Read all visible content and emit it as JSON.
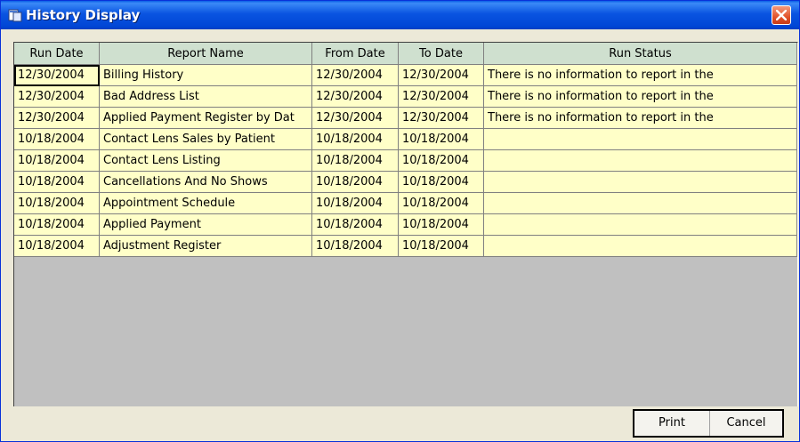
{
  "window": {
    "title": "History Display"
  },
  "table": {
    "headers": [
      "Run Date",
      "Report Name",
      "From Date",
      "To Date",
      "Run Status"
    ],
    "rows": [
      [
        "12/30/2004",
        "Billing History",
        "12/30/2004",
        "12/30/2004",
        "There is no information to report in the"
      ],
      [
        "12/30/2004",
        "Bad Address List",
        "12/30/2004",
        "12/30/2004",
        "There is no information to report in the"
      ],
      [
        "12/30/2004",
        "Applied Payment Register by Dat",
        "12/30/2004",
        "12/30/2004",
        "There is no information to report in the"
      ],
      [
        "10/18/2004",
        "Contact Lens Sales by Patient",
        "10/18/2004",
        "10/18/2004",
        ""
      ],
      [
        "10/18/2004",
        "Contact Lens Listing",
        "10/18/2004",
        "10/18/2004",
        ""
      ],
      [
        "10/18/2004",
        "Cancellations And No Shows",
        "10/18/2004",
        "10/18/2004",
        ""
      ],
      [
        "10/18/2004",
        "Appointment Schedule",
        "10/18/2004",
        "10/18/2004",
        ""
      ],
      [
        "10/18/2004",
        "Applied Payment",
        "10/18/2004",
        "10/18/2004",
        ""
      ],
      [
        "10/18/2004",
        "Adjustment Register",
        "10/18/2004",
        "10/18/2004",
        ""
      ]
    ]
  },
  "buttons": {
    "print": "Print",
    "cancel": "Cancel"
  },
  "icons": {
    "title": "window-icon",
    "close": "close-icon"
  },
  "colors": {
    "title_bar": "#0a54e1",
    "header_bg": "#cfe0cf",
    "row_bg": "#ffffc8",
    "empty_grid_bg": "#c0c0c0",
    "close_button": "#e2542c"
  }
}
